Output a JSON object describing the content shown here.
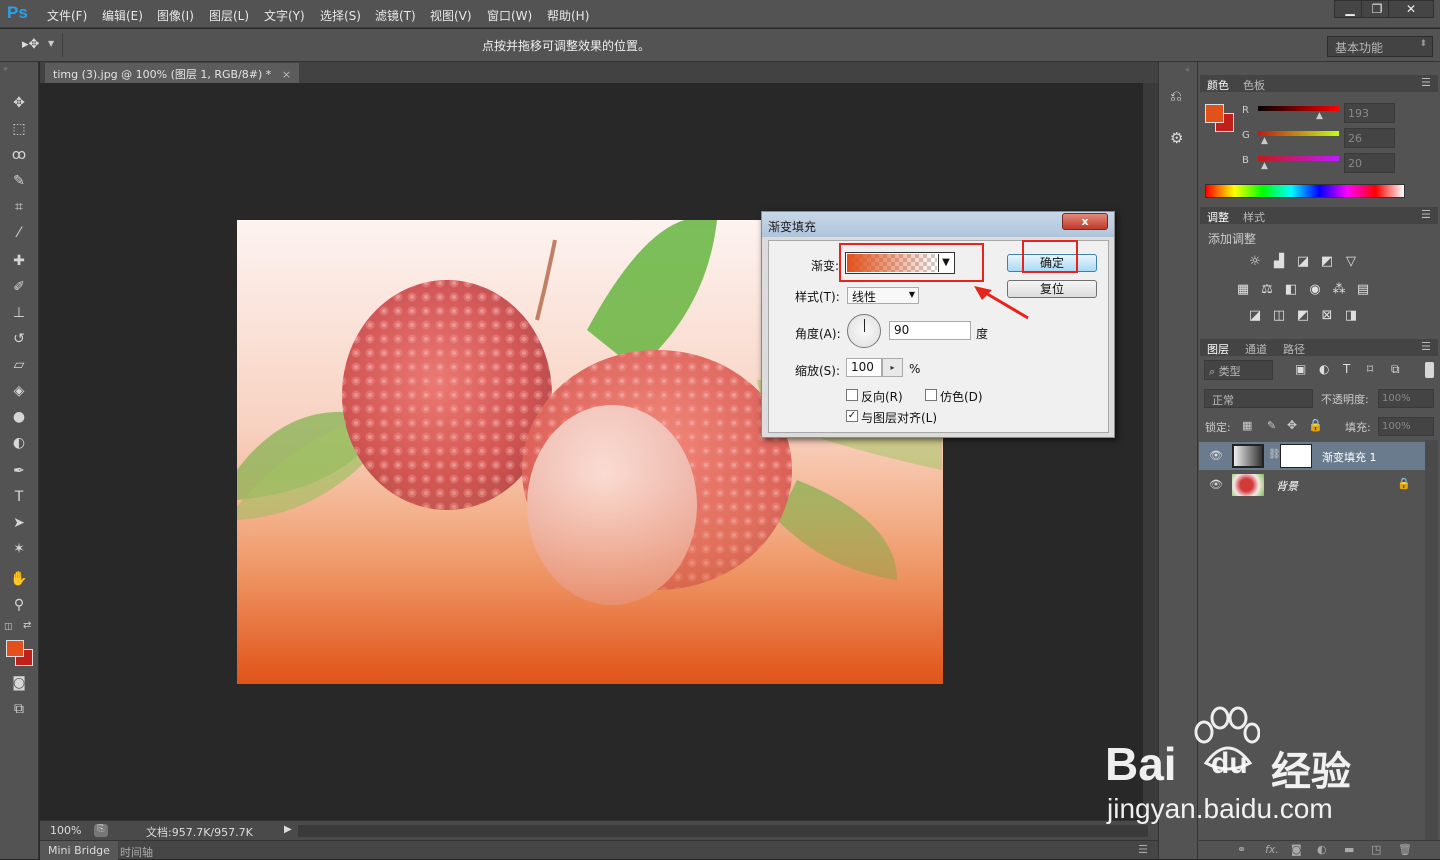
{
  "app": {
    "logo": "Ps"
  },
  "menu": [
    "文件(F)",
    "编辑(E)",
    "图像(I)",
    "图层(L)",
    "文字(Y)",
    "选择(S)",
    "滤镜(T)",
    "视图(V)",
    "窗口(W)",
    "帮助(H)"
  ],
  "window_buttons": {
    "minimize": "▁",
    "restore": "❐",
    "close": "✕"
  },
  "options_bar": {
    "hint": "点按并拖移可调整效果的位置。",
    "workspace": "基本功能"
  },
  "document_tab": {
    "title": "timg (3).jpg @ 100% (图层 1, RGB/8#) *",
    "close": "×"
  },
  "status_bar": {
    "zoom": "100%",
    "doc_info": "文档:957.7K/957.7K"
  },
  "bottom_tabs": [
    "Mini Bridge",
    "时间轴"
  ],
  "colors": {
    "foreground": "#e2511b",
    "background": "#c1201a",
    "accent_red": "#e8231c",
    "selection": "#39a6d8"
  },
  "color_panel": {
    "tabs": [
      "颜色",
      "色板"
    ],
    "channels": [
      {
        "label": "R",
        "value": "193"
      },
      {
        "label": "G",
        "value": "26"
      },
      {
        "label": "B",
        "value": "20"
      }
    ]
  },
  "adjust_panel": {
    "tabs": [
      "调整",
      "样式"
    ],
    "title": "添加调整"
  },
  "layers_panel": {
    "tabs": [
      "图层",
      "通道",
      "路径"
    ],
    "filter_label": "类型",
    "blend_mode": "正常",
    "opacity_label": "不透明度:",
    "opacity_value": "100%",
    "lock_label": "锁定:",
    "fill_label": "填充:",
    "fill_value": "100%",
    "layers": [
      {
        "name": "渐变填充 1",
        "selected": true
      },
      {
        "name": "背景",
        "locked": true
      }
    ],
    "footer_fx": "fx."
  },
  "dialog": {
    "title": "渐变填充",
    "close": "x",
    "gradient_label": "渐变:",
    "style_label": "样式(T):",
    "style_value": "线性",
    "angle_label": "角度(A):",
    "angle_value": "90",
    "angle_unit": "度",
    "scale_label": "缩放(S):",
    "scale_value": "100",
    "scale_unit": "%",
    "reverse_label": "反向(R)",
    "dither_label": "仿色(D)",
    "align_label": "与图层对齐(L)",
    "reverse_checked": false,
    "dither_checked": false,
    "align_checked": true,
    "ok_button": "确定",
    "reset_button": "复位"
  },
  "watermark": {
    "brand": "Bai",
    "brand2": "du",
    "brand_cn": "经验",
    "url": "jingyan.baidu.com"
  }
}
